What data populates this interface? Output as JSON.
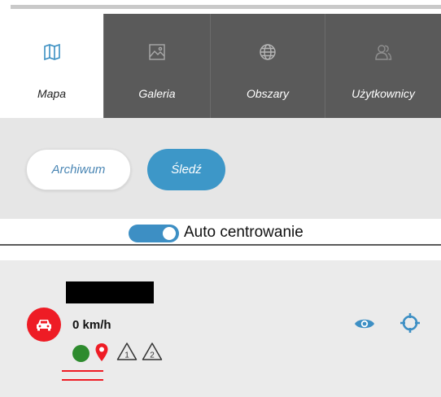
{
  "tabs": [
    {
      "label": "Mapa",
      "icon": "map-icon",
      "active": true
    },
    {
      "label": "Galeria",
      "icon": "image-icon",
      "active": false
    },
    {
      "label": "Obszary",
      "icon": "globe-icon",
      "active": false
    },
    {
      "label": "Użytkownicy",
      "icon": "users-icon",
      "active": false
    }
  ],
  "mode": {
    "archive_label": "Archiwum",
    "track_label": "Śledź",
    "active": "track"
  },
  "autocenter": {
    "label": "Auto centrowanie",
    "enabled": true
  },
  "vehicle": {
    "speed": "0 km/h",
    "status_color": "#2e8b2e",
    "warnings": [
      "1",
      "2"
    ]
  },
  "colors": {
    "accent": "#3d97c8",
    "tab_bg": "#5a5a5a",
    "alert_red": "#ee1c25"
  }
}
